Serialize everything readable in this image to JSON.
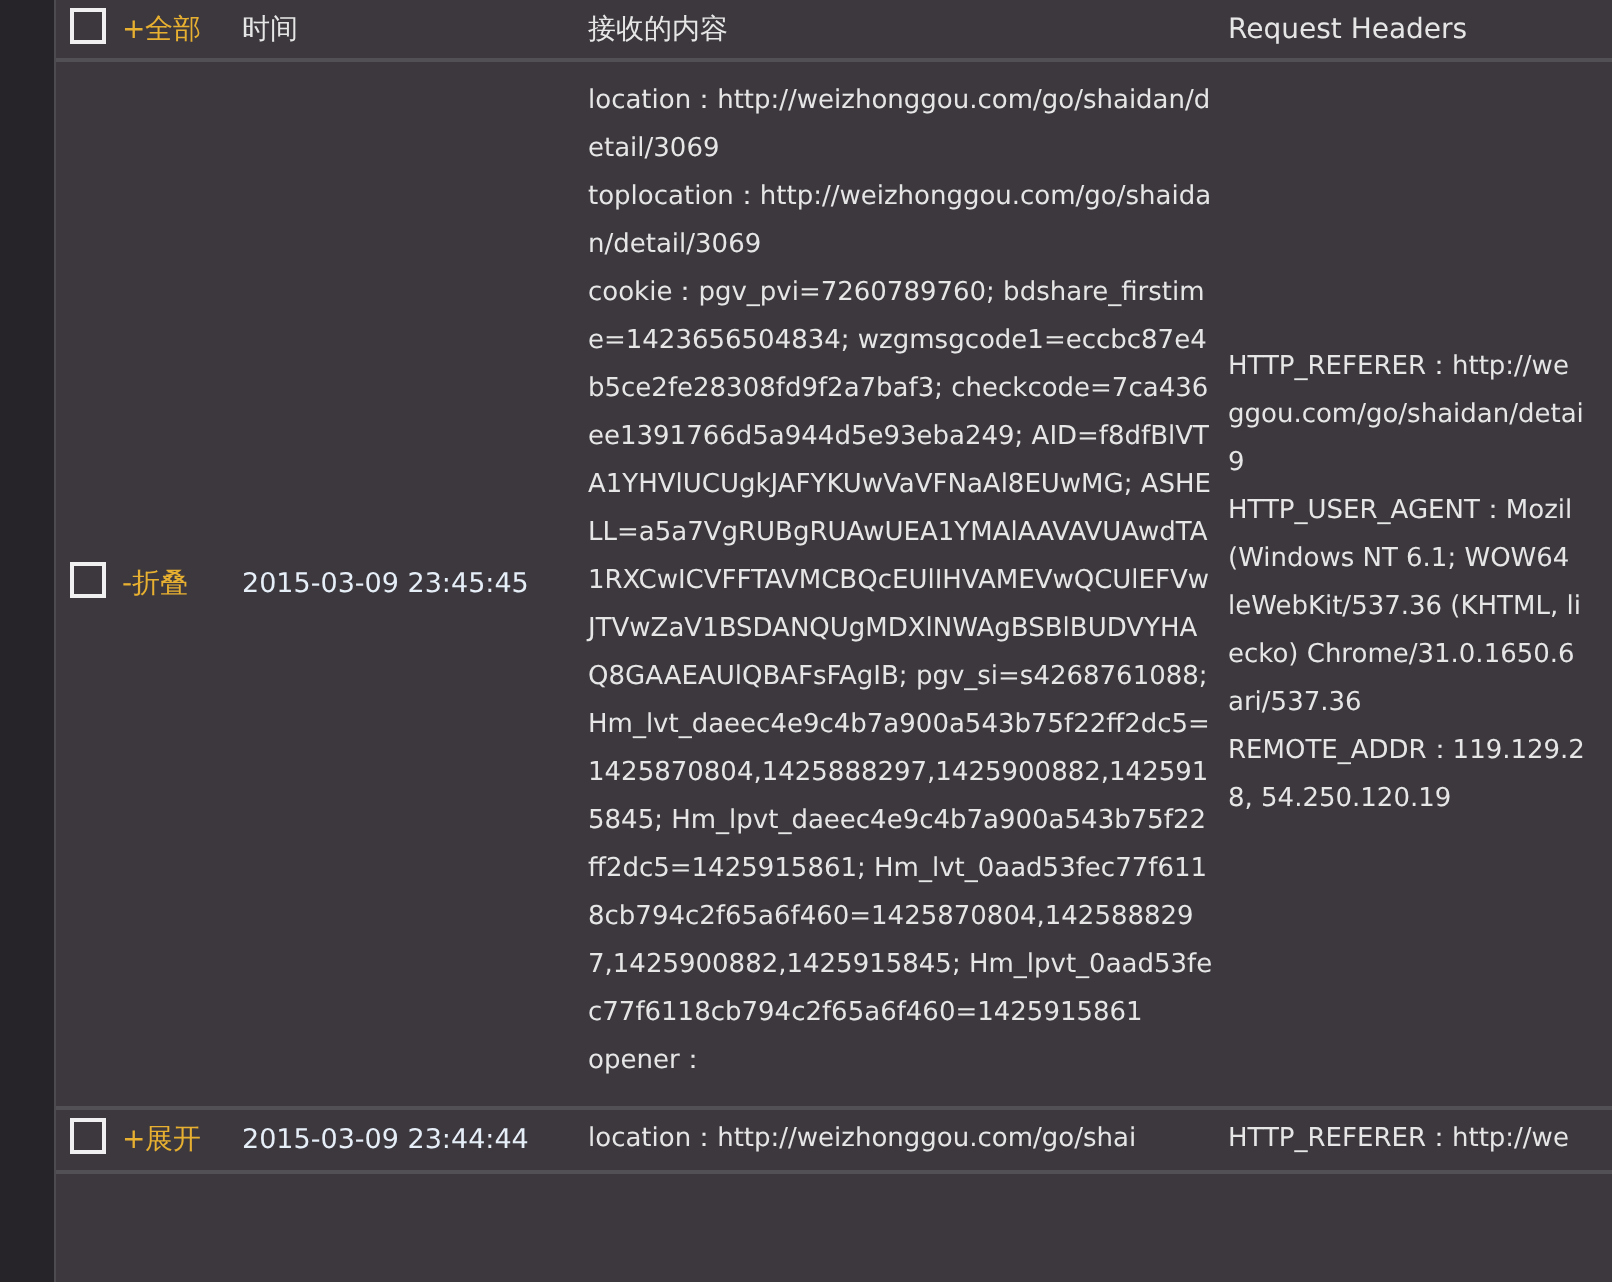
{
  "table": {
    "select_all": {
      "checked": false
    },
    "toggle_all": "+全部",
    "columns": [
      "时间",
      "接收的内容",
      "Request Headers"
    ],
    "rows": [
      {
        "checked": false,
        "expanded": true,
        "toggle": "-折叠",
        "time": "2015-03-09 23:45:45",
        "content": [
          "location：http://weizhonggou.com/go/shaidan/detail/3069",
          "toplocation：http://weizhonggou.com/go/shaidan/detail/3069",
          "cookie：pgv_pvi=7260789760; bdshare_firstime=1423656504834; wzgmsgcode1=eccbc87e4b5ce2fe28308fd9f2a7baf3; checkcode=7ca436ee1391766d5a944d5e93eba249; AID=f8dfBlVTA1YHVlUCUgkJAFYKUwVaVFNaAl8EUwMG; ASHELL=a5a7VgRUBgRUAwUEA1YMAlAAVAVUAwdTA1RXCwICVFFTAVMCBQcEUlIHVAMEVwQCUlEFVwJTVwZaV1BSDANQUgMDXlNWAgBSBlBUDVYHAQ8GAAEAUlQBAFsFAgIB; pgv_si=s4268761088; Hm_lvt_daeec4e9c4b7a900a543b75f22ff2dc5=1425870804,1425888297,1425900882,1425915845; Hm_lpvt_daeec4e9c4b7a900a543b75f22ff2dc5=1425915861; Hm_lvt_0aad53fec77f6118cb794c2f65a6f460=1425870804,1425888297,1425900882,1425915845; Hm_lpvt_0aad53fec77f6118cb794c2f65a6f460=1425915861",
          "opener："
        ],
        "headers": [
          "HTTP_REFERER：http://we",
          "ggou.com/go/shaidan/detai",
          "9",
          "HTTP_USER_AGENT：Mozil",
          "(Windows NT 6.1; WOW64",
          "leWebKit/537.36 (KHTML, li",
          "ecko) Chrome/31.0.1650.6",
          "ari/537.36",
          "REMOTE_ADDR：119.129.2",
          "8, 54.250.120.19"
        ]
      },
      {
        "checked": false,
        "expanded": false,
        "toggle": "+展开",
        "time": "2015-03-09 23:44:44",
        "content": [
          "location：http://weizhonggou.com/go/shai"
        ],
        "headers": [
          "HTTP_REFERER：http://we"
        ]
      }
    ]
  }
}
